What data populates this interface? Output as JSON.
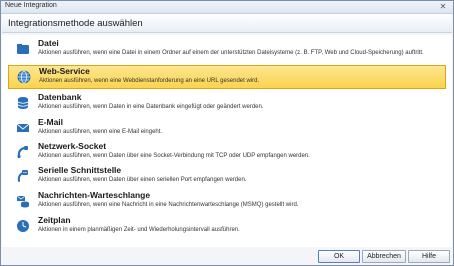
{
  "window": {
    "title": "Neue Integration",
    "close_glyph": "✕"
  },
  "header": {
    "title": "Integrationsmethode auswählen"
  },
  "items": [
    {
      "title": "Datei",
      "desc": "Aktionen ausführen, wenn eine Datei in einem Ordner auf einem der unterstützten Dateisysteme (z. B. FTP, Web und Cloud-Speicherung) auftritt.",
      "icon": "folder-icon",
      "selected": false
    },
    {
      "title": "Web-Service",
      "desc": "Aktionen ausführen, wenn eine Webdienstanforderung an eine URL gesendet wird.",
      "icon": "globe-icon",
      "selected": true
    },
    {
      "title": "Datenbank",
      "desc": "Aktionen ausführen, wenn Daten in eine Datenbank eingefügt oder geändert werden.",
      "icon": "database-icon",
      "selected": false
    },
    {
      "title": "E-Mail",
      "desc": "Aktionen ausführen, wenn eine E-Mail eingeht.",
      "icon": "email-icon",
      "selected": false
    },
    {
      "title": "Netzwerk-Socket",
      "desc": "Aktionen ausführen, wenn Daten über eine Socket-Verbindung mit TCP oder UDP empfangen werden.",
      "icon": "network-socket-icon",
      "selected": false
    },
    {
      "title": "Serielle Schnittstelle",
      "desc": "Aktionen ausführen, wenn Daten über einen seriellen Port empfangen werden.",
      "icon": "serial-port-icon",
      "selected": false
    },
    {
      "title": "Nachrichten-Warteschlange",
      "desc": "Aktionen ausführen, wenn eine Nachricht in eine Nachrichtenwarteschlange (MSMQ) gestellt wird.",
      "icon": "message-queue-icon",
      "selected": false
    },
    {
      "title": "Zeitplan",
      "desc": "Aktionen in einem planmäßigen Zeit- und Wiederholungsintervall ausführen.",
      "icon": "clock-icon",
      "selected": false
    }
  ],
  "buttons": {
    "ok": "OK",
    "cancel": "Abbrechen",
    "help": "Hilfe"
  },
  "colors": {
    "selection": "#fbd34d",
    "selection_border": "#e0a416",
    "icon_blue": "#2a6fb8"
  }
}
